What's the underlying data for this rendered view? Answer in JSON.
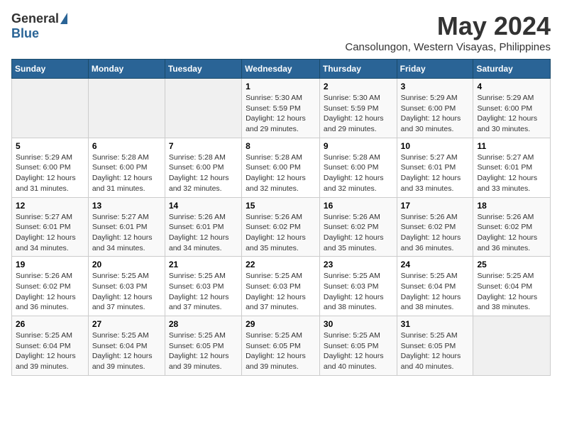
{
  "logo": {
    "general": "General",
    "blue": "Blue"
  },
  "title": "May 2024",
  "location": "Cansolungon, Western Visayas, Philippines",
  "days_of_week": [
    "Sunday",
    "Monday",
    "Tuesday",
    "Wednesday",
    "Thursday",
    "Friday",
    "Saturday"
  ],
  "weeks": [
    [
      {
        "num": "",
        "info": ""
      },
      {
        "num": "",
        "info": ""
      },
      {
        "num": "",
        "info": ""
      },
      {
        "num": "1",
        "info": "Sunrise: 5:30 AM\nSunset: 5:59 PM\nDaylight: 12 hours\nand 29 minutes."
      },
      {
        "num": "2",
        "info": "Sunrise: 5:30 AM\nSunset: 5:59 PM\nDaylight: 12 hours\nand 29 minutes."
      },
      {
        "num": "3",
        "info": "Sunrise: 5:29 AM\nSunset: 6:00 PM\nDaylight: 12 hours\nand 30 minutes."
      },
      {
        "num": "4",
        "info": "Sunrise: 5:29 AM\nSunset: 6:00 PM\nDaylight: 12 hours\nand 30 minutes."
      }
    ],
    [
      {
        "num": "5",
        "info": "Sunrise: 5:29 AM\nSunset: 6:00 PM\nDaylight: 12 hours\nand 31 minutes."
      },
      {
        "num": "6",
        "info": "Sunrise: 5:28 AM\nSunset: 6:00 PM\nDaylight: 12 hours\nand 31 minutes."
      },
      {
        "num": "7",
        "info": "Sunrise: 5:28 AM\nSunset: 6:00 PM\nDaylight: 12 hours\nand 32 minutes."
      },
      {
        "num": "8",
        "info": "Sunrise: 5:28 AM\nSunset: 6:00 PM\nDaylight: 12 hours\nand 32 minutes."
      },
      {
        "num": "9",
        "info": "Sunrise: 5:28 AM\nSunset: 6:00 PM\nDaylight: 12 hours\nand 32 minutes."
      },
      {
        "num": "10",
        "info": "Sunrise: 5:27 AM\nSunset: 6:01 PM\nDaylight: 12 hours\nand 33 minutes."
      },
      {
        "num": "11",
        "info": "Sunrise: 5:27 AM\nSunset: 6:01 PM\nDaylight: 12 hours\nand 33 minutes."
      }
    ],
    [
      {
        "num": "12",
        "info": "Sunrise: 5:27 AM\nSunset: 6:01 PM\nDaylight: 12 hours\nand 34 minutes."
      },
      {
        "num": "13",
        "info": "Sunrise: 5:27 AM\nSunset: 6:01 PM\nDaylight: 12 hours\nand 34 minutes."
      },
      {
        "num": "14",
        "info": "Sunrise: 5:26 AM\nSunset: 6:01 PM\nDaylight: 12 hours\nand 34 minutes."
      },
      {
        "num": "15",
        "info": "Sunrise: 5:26 AM\nSunset: 6:02 PM\nDaylight: 12 hours\nand 35 minutes."
      },
      {
        "num": "16",
        "info": "Sunrise: 5:26 AM\nSunset: 6:02 PM\nDaylight: 12 hours\nand 35 minutes."
      },
      {
        "num": "17",
        "info": "Sunrise: 5:26 AM\nSunset: 6:02 PM\nDaylight: 12 hours\nand 36 minutes."
      },
      {
        "num": "18",
        "info": "Sunrise: 5:26 AM\nSunset: 6:02 PM\nDaylight: 12 hours\nand 36 minutes."
      }
    ],
    [
      {
        "num": "19",
        "info": "Sunrise: 5:26 AM\nSunset: 6:02 PM\nDaylight: 12 hours\nand 36 minutes."
      },
      {
        "num": "20",
        "info": "Sunrise: 5:25 AM\nSunset: 6:03 PM\nDaylight: 12 hours\nand 37 minutes."
      },
      {
        "num": "21",
        "info": "Sunrise: 5:25 AM\nSunset: 6:03 PM\nDaylight: 12 hours\nand 37 minutes."
      },
      {
        "num": "22",
        "info": "Sunrise: 5:25 AM\nSunset: 6:03 PM\nDaylight: 12 hours\nand 37 minutes."
      },
      {
        "num": "23",
        "info": "Sunrise: 5:25 AM\nSunset: 6:03 PM\nDaylight: 12 hours\nand 38 minutes."
      },
      {
        "num": "24",
        "info": "Sunrise: 5:25 AM\nSunset: 6:04 PM\nDaylight: 12 hours\nand 38 minutes."
      },
      {
        "num": "25",
        "info": "Sunrise: 5:25 AM\nSunset: 6:04 PM\nDaylight: 12 hours\nand 38 minutes."
      }
    ],
    [
      {
        "num": "26",
        "info": "Sunrise: 5:25 AM\nSunset: 6:04 PM\nDaylight: 12 hours\nand 39 minutes."
      },
      {
        "num": "27",
        "info": "Sunrise: 5:25 AM\nSunset: 6:04 PM\nDaylight: 12 hours\nand 39 minutes."
      },
      {
        "num": "28",
        "info": "Sunrise: 5:25 AM\nSunset: 6:05 PM\nDaylight: 12 hours\nand 39 minutes."
      },
      {
        "num": "29",
        "info": "Sunrise: 5:25 AM\nSunset: 6:05 PM\nDaylight: 12 hours\nand 39 minutes."
      },
      {
        "num": "30",
        "info": "Sunrise: 5:25 AM\nSunset: 6:05 PM\nDaylight: 12 hours\nand 40 minutes."
      },
      {
        "num": "31",
        "info": "Sunrise: 5:25 AM\nSunset: 6:05 PM\nDaylight: 12 hours\nand 40 minutes."
      },
      {
        "num": "",
        "info": ""
      }
    ]
  ]
}
